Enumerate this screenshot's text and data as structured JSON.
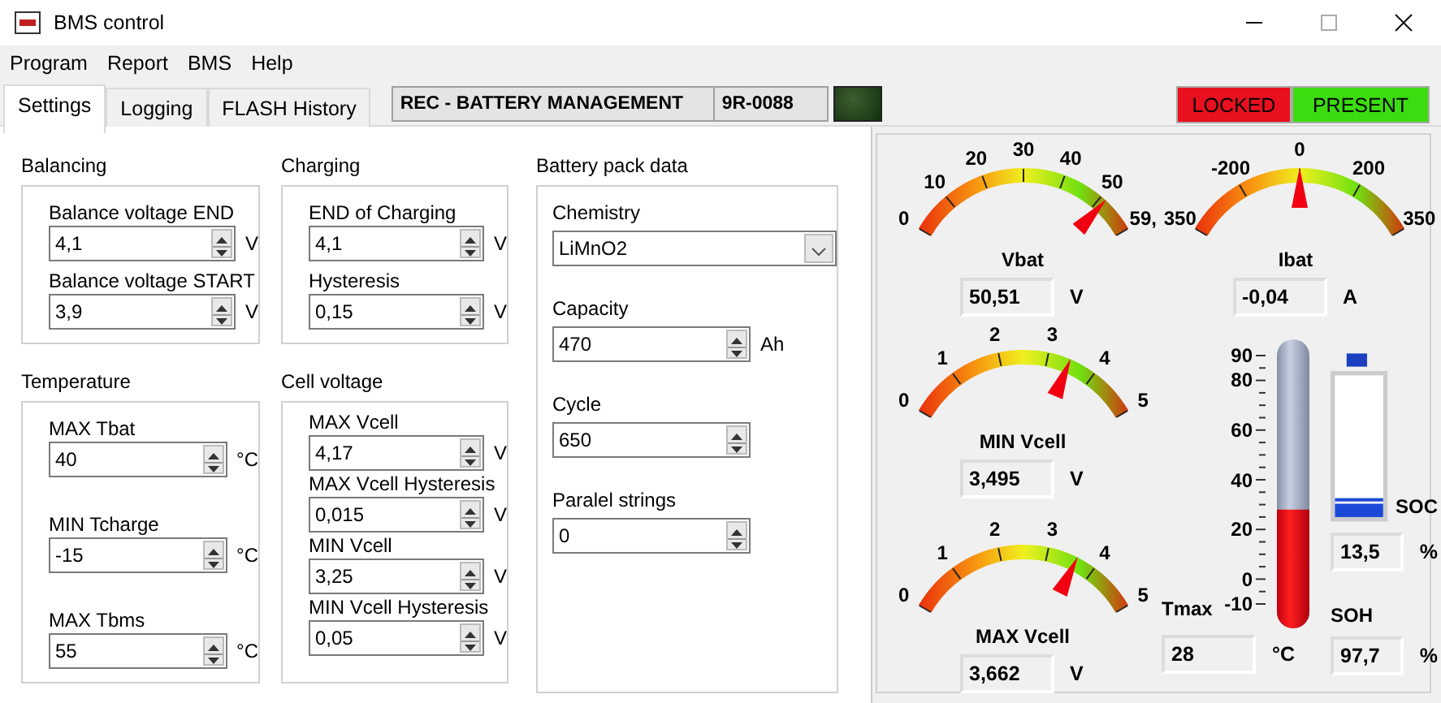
{
  "window": {
    "title": "BMS control"
  },
  "menu": [
    "Program",
    "Report",
    "BMS",
    "Help"
  ],
  "tabs": [
    {
      "label": "Settings",
      "selected": true
    },
    {
      "label": "Logging",
      "selected": false
    },
    {
      "label": "FLASH History",
      "selected": false
    }
  ],
  "device": {
    "name": "REC - BATTERY MANAGEMENT",
    "serial": "9R-0088",
    "led_on": false
  },
  "indicators": [
    {
      "label": "LOCKED",
      "color": "#e8101e"
    },
    {
      "label": "PRESENT",
      "color": "#3cdc10"
    }
  ],
  "groups": [
    {
      "title": "Balancing",
      "fields": [
        {
          "label": "Balance voltage END",
          "value": "4,1",
          "unit": "V"
        },
        {
          "label": "Balance voltage START",
          "value": "3,9",
          "unit": "V"
        }
      ]
    },
    {
      "title": "Charging",
      "fields": [
        {
          "label": "END of Charging",
          "value": "4,1",
          "unit": "V"
        },
        {
          "label": "Hysteresis",
          "value": "0,15",
          "unit": "V"
        }
      ]
    },
    {
      "title": "Temperature",
      "fields": [
        {
          "label": "MAX Tbat",
          "value": "40",
          "unit": "°C"
        },
        {
          "label": "MIN Tcharge",
          "value": "-15",
          "unit": "°C"
        },
        {
          "label": "MAX Tbms",
          "value": "55",
          "unit": "°C"
        }
      ]
    },
    {
      "title": "Cell voltage",
      "fields": [
        {
          "label": "MAX Vcell",
          "value": "4,17",
          "unit": "V"
        },
        {
          "label": "MAX Vcell Hysteresis",
          "value": "0,015",
          "unit": "V"
        },
        {
          "label": "MIN Vcell",
          "value": "3,25",
          "unit": "V"
        },
        {
          "label": "MIN Vcell Hysteresis",
          "value": "0,05",
          "unit": "V"
        }
      ]
    }
  ],
  "battery_pack": {
    "title": "Battery pack data",
    "fields": [
      {
        "kind": "dropdown",
        "label": "Chemistry",
        "value": "LiMnO2"
      },
      {
        "kind": "spin",
        "label": "Capacity",
        "value": "470",
        "unit": "Ah"
      },
      {
        "kind": "spin",
        "label": "Cycle",
        "value": "650"
      },
      {
        "kind": "spin",
        "label": "Paralel strings",
        "value": "0"
      }
    ]
  },
  "gauges": [
    {
      "label": "Vbat",
      "ticks": [
        "0",
        "10",
        "20",
        "30",
        "40",
        "50",
        "59,"
      ],
      "level": 0.85,
      "reading": "50,51",
      "unit": "V"
    },
    {
      "label": "Ibat",
      "ticks": [
        "350",
        "-200",
        "0",
        "200",
        "350"
      ],
      "level": 0.5,
      "reading": "-0,04",
      "unit": "A"
    },
    {
      "label": "MIN Vcell",
      "ticks": [
        "0",
        "1",
        "2",
        "3",
        "4",
        "5"
      ],
      "level": 0.7,
      "reading": "3,495",
      "unit": "V"
    },
    {
      "label": "MAX Vcell",
      "ticks": [
        "0",
        "1",
        "2",
        "3",
        "4",
        "5"
      ],
      "level": 0.73,
      "reading": "3,662",
      "unit": "V"
    }
  ],
  "thermometer": {
    "ticks": [
      "90",
      "80",
      "60",
      "40",
      "20",
      "0",
      "-10"
    ],
    "level": 0.38,
    "label": "Tmax",
    "reading": "28",
    "unit": "°C"
  },
  "soc": {
    "label": "SOC",
    "level": 0.135,
    "reading": "13,5",
    "unit": "%"
  },
  "soh": {
    "label": "SOH",
    "reading": "97,7",
    "unit": "%"
  }
}
